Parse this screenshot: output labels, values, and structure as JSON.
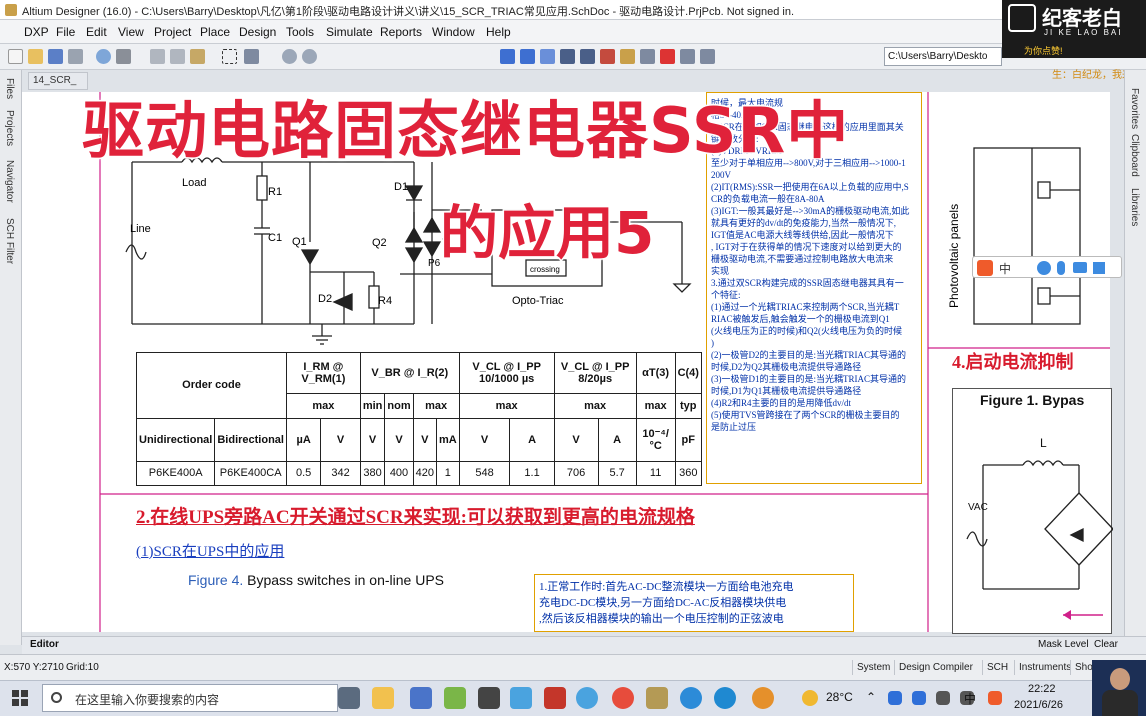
{
  "window": {
    "title": "Altium Designer (16.0) - C:\\Users\\Barry\\Desktop\\凡亿\\第1阶段\\驱动电路设计讲义\\讲义\\15_SCR_TRIAC常见应用.SchDoc - 驱动电路设计.PrjPcb. Not signed in."
  },
  "menu": [
    "DXP",
    "File",
    "Edit",
    "View",
    "Project",
    "Place",
    "Design",
    "Tools",
    "Simulate",
    "Reports",
    "Window",
    "Help"
  ],
  "toolbar": {
    "path_field": "C:\\Users\\Barry\\Deskto"
  },
  "doc_tab": {
    "label": "14_SCR_"
  },
  "left_panel_tabs": [
    "Files",
    "Projects",
    "Navigator",
    "SCH Filter"
  ],
  "right_panel_tabs": [
    "Favorites",
    "Clipboard",
    "Libraries"
  ],
  "overlay": {
    "line1": "驱动电路固态继电器SSR中",
    "line2": "的应用5"
  },
  "watermark": {
    "brand": "纪客老白",
    "sub": "JI KE LAO BAI",
    "comment1": "为你点赞!",
    "comment2": "生：白纪龙，我来"
  },
  "schematic": {
    "labels": [
      "Load",
      "R1",
      "C1",
      "Line",
      "Q1",
      "D2",
      "R4",
      "D1",
      "Q2",
      "T",
      "P6",
      "crossing",
      "Opto-Triac"
    ]
  },
  "spec_table": {
    "header_row1": [
      "Order code",
      "I_RM @ V_RM(1)",
      "V_BR @ I_R(2)",
      "V_CL @ I_PP 10/1000 µs",
      "V_CL @ I_PP 8/20µs",
      "αT(3)",
      "C(4)"
    ],
    "header_row2": [
      "max",
      "min",
      "nom",
      "max",
      "max",
      "max",
      "max",
      "typ"
    ],
    "header_row3": [
      "Unidirectional",
      "Bidirectional",
      "µA",
      "V",
      "V",
      "V",
      "V",
      "mA",
      "V",
      "A",
      "V",
      "A",
      "10⁻⁴/°C",
      "pF"
    ],
    "row": [
      "P6KE400A",
      "P6KE400CA",
      "0.5",
      "342",
      "380",
      "400",
      "420",
      "1",
      "548",
      "1.1",
      "706",
      "5.7",
      "11",
      "360"
    ]
  },
  "notes_right": [
    "时候，最大电流规",
    "格30-40A",
    "2.SCR在诸如SSR固态继电器这样的应用里面其关",
    "键参数分析:",
    "(1)VDRM / VRRM",
    "至少对于单相应用-->800V,对于三相应用-->1000-1",
    "200V",
    "(2)IT(RMS):SSR一把使用在6A以上负载的应用中,S",
    "CR的负载电流一般在8A-80A",
    "(3)IGT:一般其最好是-->30mA的栅极驱动电流,如此",
    "就具有更好的dv/dt的免疫能力,当然一般情况下,",
    "IGT值是AC电源大线等线供给,因此一般情况下",
    ", IGT对于在获得单的情况下速度对以给到更大的",
    "栅极驱动电流,不需要通过控制电路放大电流来",
    "实现",
    "3.通过双SCR构建完成的SSR固态继电器其具有一",
    "个特征:",
    "(1)通过一个光耦TRIAC来控制两个SCR,当光耦T",
    "RIAC被触发后,触会触发一个的栅极电流到Q1",
    "(火线电压为正的时候)和Q2(火线电压为负的时候",
    ")",
    "(2)一极管D2的主要目的是:当光耦TRIAC其导通的",
    "时候,D2为Q2其栅极电流提供导通路径",
    "(3)一极管D1的主要目的是:当光耦TRIAC其导通的",
    "时候,D1为Q1其栅极电流提供导通路径",
    "(4)R2和R4主要的目的是用降低dv/dt",
    "(5)使用TVS管跨接在了两个SCR的栅极主要目的",
    "是防止过压"
  ],
  "heading_ups": "2.在线UPS旁路AC开关通过SCR来实现:可以获取到更高的电流规格",
  "heading_scr": "(1)SCR在UPS中的应用",
  "figure4": {
    "prefix": "Figure 4.",
    "text": "Bypass switches in on-line UPS"
  },
  "notes_bottom": [
    "1.正常工作时:首先AC-DC整流模块一方面给电池充电",
    "充电DC-DC模块,另一方面给DC-AC反相器模块供电",
    ",然后该反相器模块的输出一个电压控制的正弦波电"
  ],
  "heading_startup": "4.启动电流抑制",
  "figure1": {
    "label": "Figure 1. Bypas",
    "L": "L",
    "Vac": "VAC"
  },
  "photovoltaic_label": "Photovoltaic panels",
  "editor_tab": "Editor",
  "mask_level": "Mask Level",
  "clear": "Clear",
  "status": {
    "coords": "X:570 Y:2710",
    "grid": "Grid:10",
    "tabs": [
      "System",
      "Design Compiler",
      "SCH",
      "Instruments",
      "Shor"
    ]
  },
  "taskbar": {
    "search_placeholder": "在这里输入你要搜索的内容",
    "weather": "28°C",
    "time": "22:22",
    "date": "2021/6/26"
  },
  "colors": {
    "accent_red": "#e0223a",
    "blue_note": "#0030a8",
    "magenta_line": "#d0208a"
  }
}
